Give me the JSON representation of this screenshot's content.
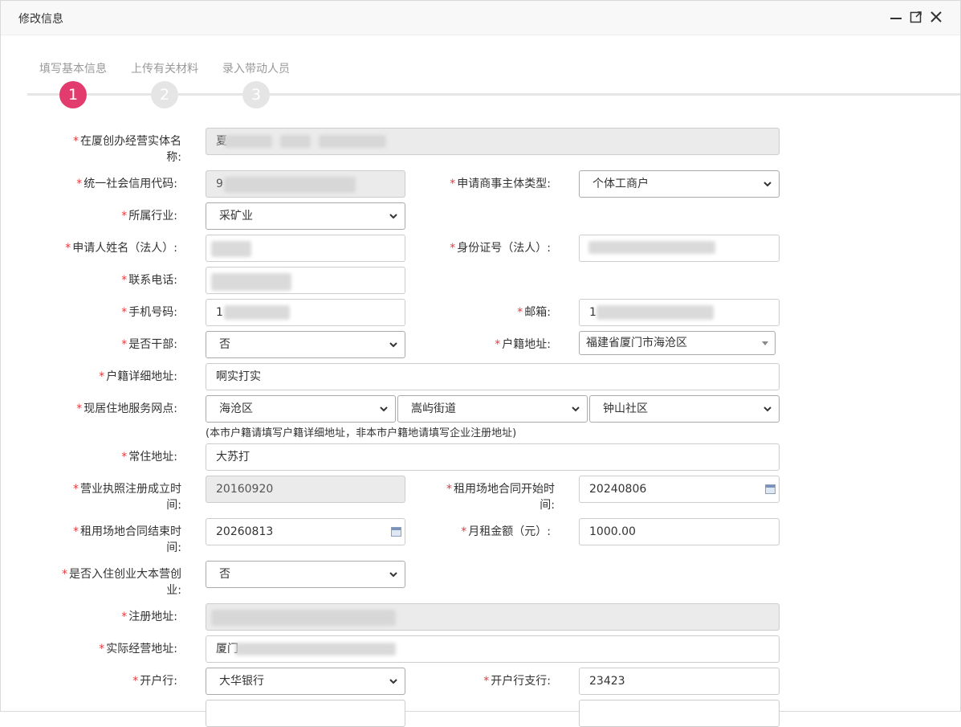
{
  "dialog": {
    "title": "修改信息",
    "controls": [
      "minimize-icon",
      "maximize-icon",
      "close-icon"
    ]
  },
  "steps": [
    {
      "label": "填写基本信息",
      "number": "1",
      "active": true
    },
    {
      "label": "上传有关材料",
      "number": "2",
      "active": false
    },
    {
      "label": "录入带动人员",
      "number": "3",
      "active": false
    }
  ],
  "form": {
    "entity_name": {
      "label_l1": "在厦创办经营实体名",
      "label_l2": "称:",
      "value": "夏"
    },
    "credit_code": {
      "label": "统一社会信用代码:",
      "value": "9"
    },
    "entity_type": {
      "label": "申请商事主体类型:",
      "value": "个体工商户"
    },
    "industry": {
      "label": "所属行业:",
      "value": "采矿业"
    },
    "applicant_name": {
      "label": "申请人姓名（法人）:",
      "value": ""
    },
    "id_number": {
      "label": "身份证号（法人）:",
      "value": ""
    },
    "contact_phone": {
      "label": "联系电话:",
      "value": ""
    },
    "mobile": {
      "label": "手机号码:",
      "value": "1"
    },
    "email": {
      "label": "邮箱:",
      "value": "1"
    },
    "is_cadre": {
      "label": "是否干部:",
      "value": "否"
    },
    "household_addr": {
      "label": "户籍地址:",
      "value": "福建省厦门市海沧区"
    },
    "household_detail": {
      "label": "户籍详细地址:",
      "value": "啊实打实"
    },
    "residence_service": {
      "label": "现居住地服务网点:",
      "district": "海沧区",
      "street": "嵩屿街道",
      "community": "钟山社区",
      "note": "(本市户籍请填写户籍详细地址，非本市户籍地请填写企业注册地址)"
    },
    "permanent_addr": {
      "label": "常住地址:",
      "value": "大苏打"
    },
    "license_date": {
      "label_l1": "营业执照注册成立时",
      "label_l2": "间:",
      "value": "20160920"
    },
    "lease_start": {
      "label_l1": "租用场地合同开始时",
      "label_l2": "间:",
      "value": "20240806"
    },
    "lease_end": {
      "label_l1": "租用场地合同结束时",
      "label_l2": "间:",
      "value": "20260813"
    },
    "monthly_rent": {
      "label": "月租金额（元）:",
      "value": "1000.00"
    },
    "in_camp": {
      "label_l1": "是否入住创业大本营创",
      "label_l2": "业:",
      "value": "否"
    },
    "reg_addr": {
      "label": "注册地址:",
      "value": ""
    },
    "actual_addr": {
      "label": "实际经营地址:",
      "value": "厦门"
    },
    "bank": {
      "label": "开户行:",
      "value": "大华银行"
    },
    "bank_branch": {
      "label": "开户行支行:",
      "value": "23423"
    }
  },
  "colors": {
    "accent": "#e23b6e",
    "required": "#e4393c"
  }
}
